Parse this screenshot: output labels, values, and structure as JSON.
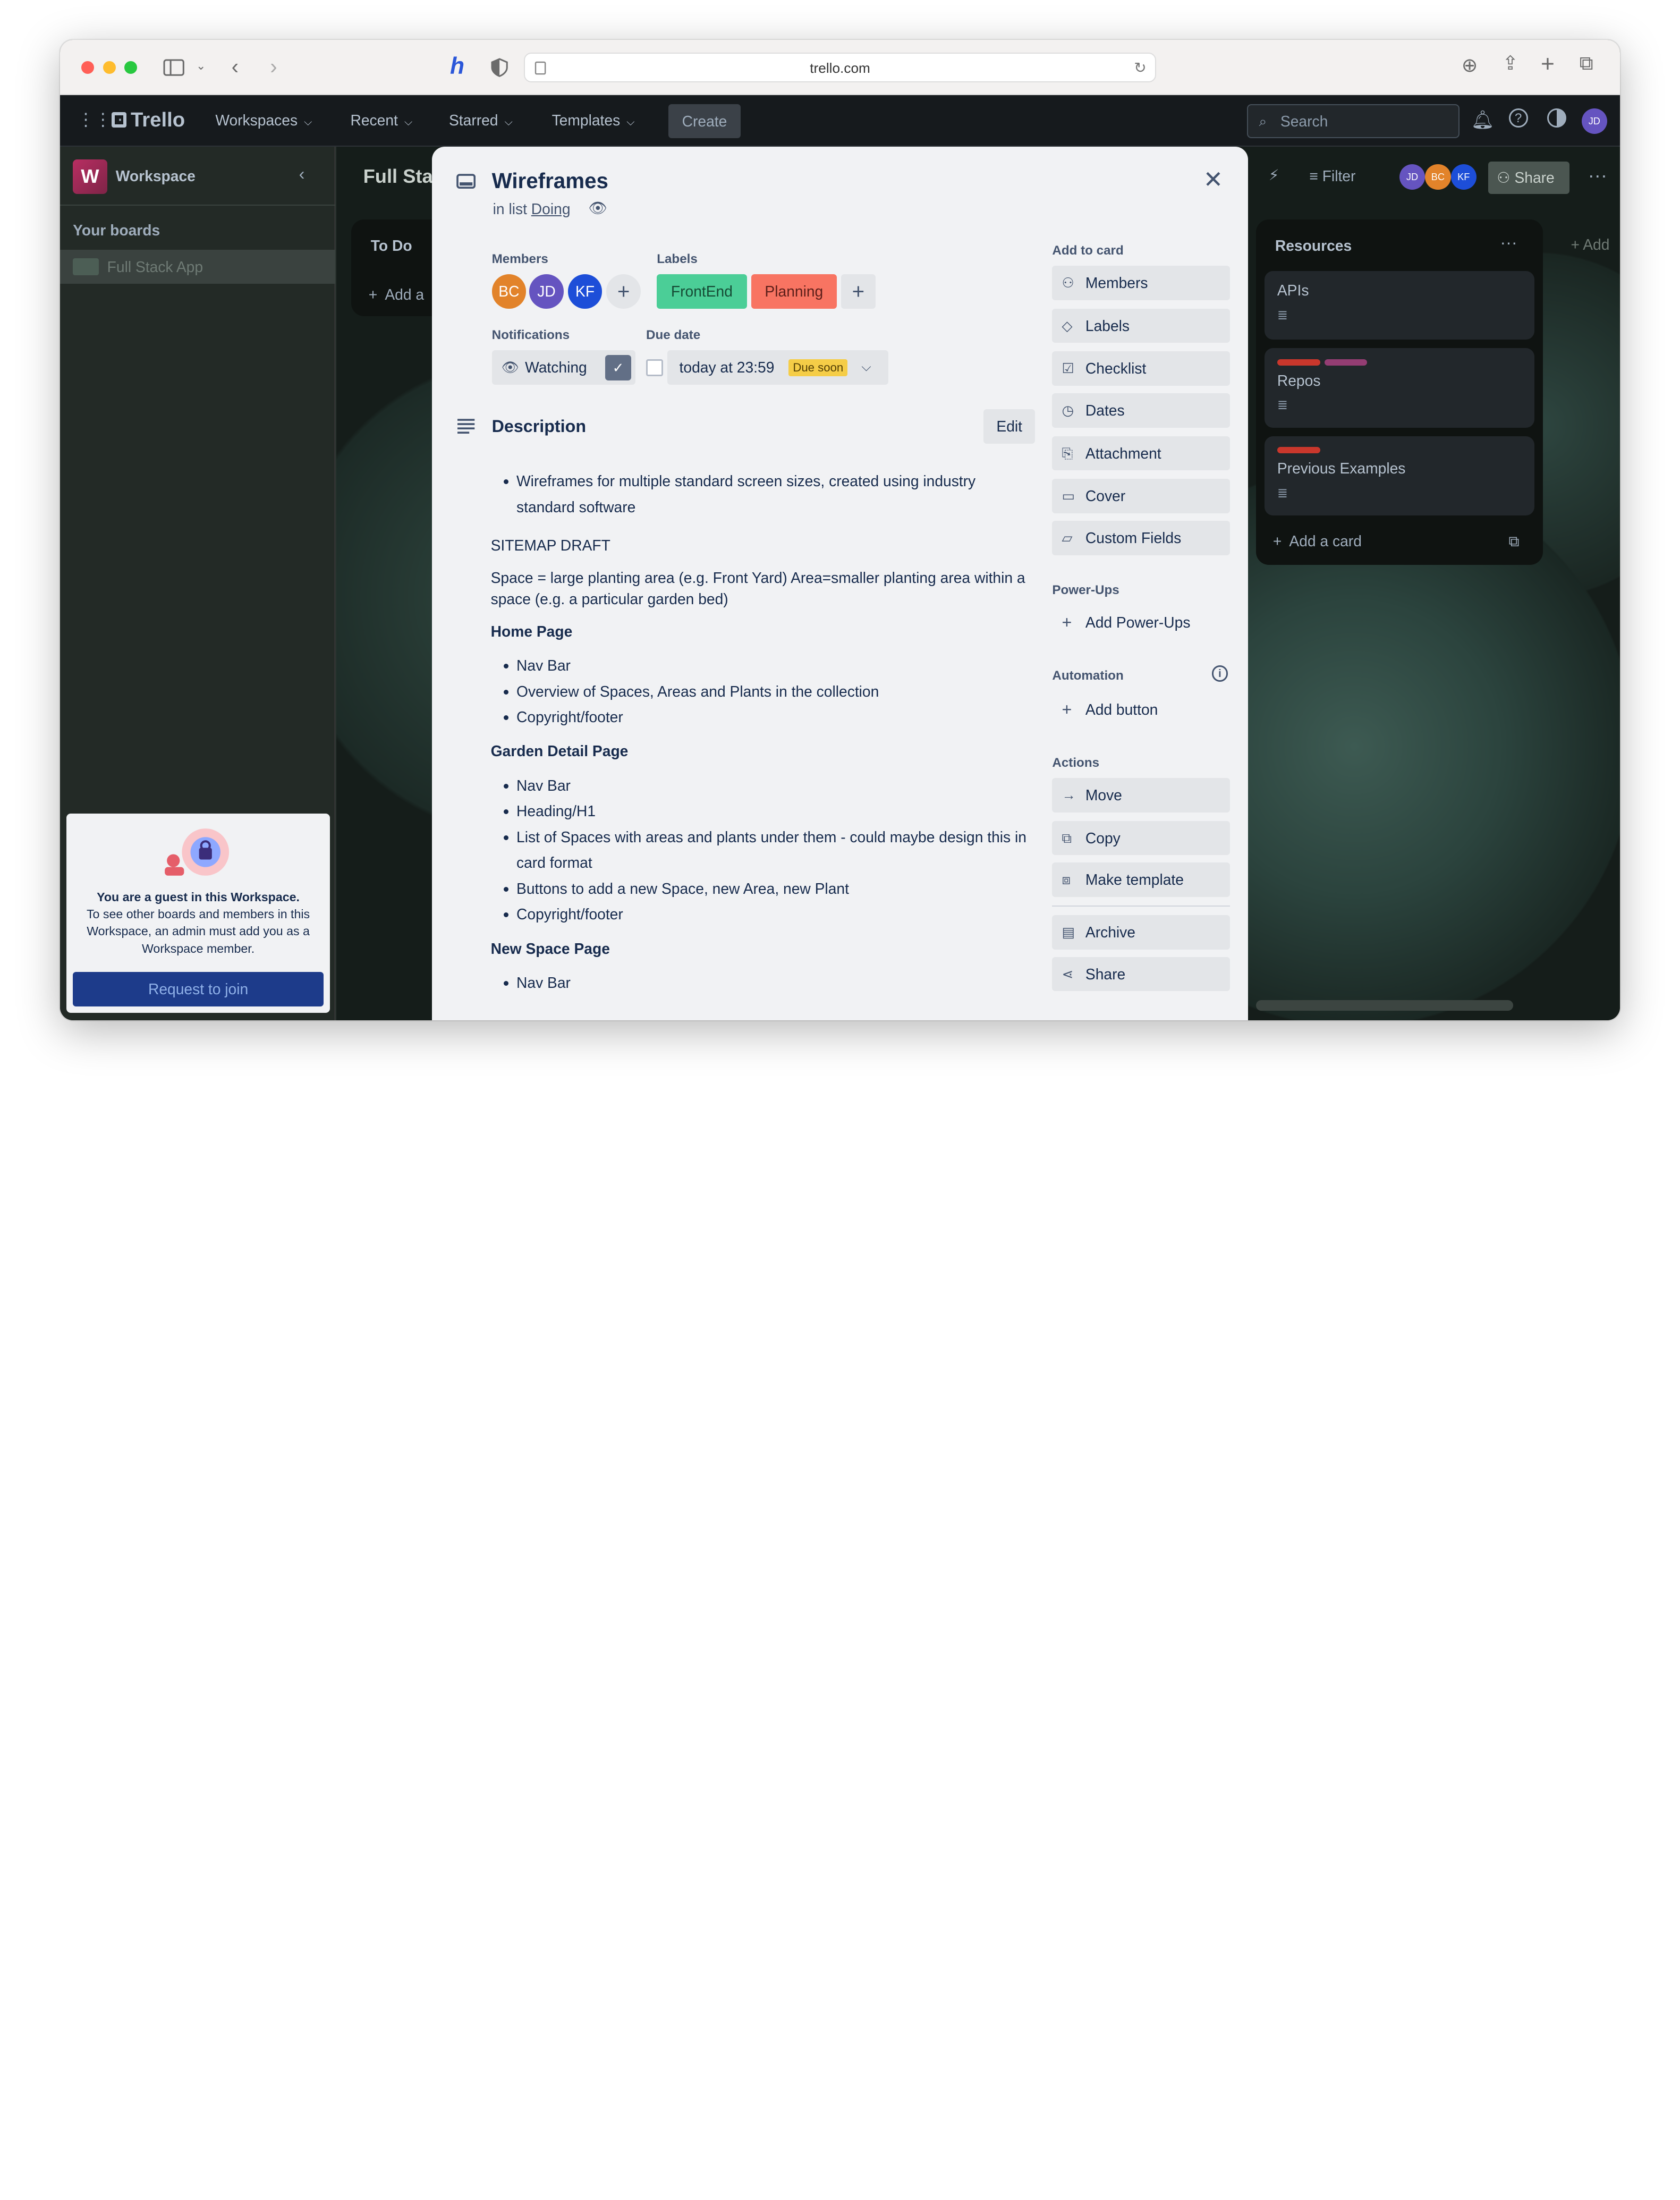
{
  "browser": {
    "url": "trello.com"
  },
  "header": {
    "logo": "Trello",
    "menus": [
      "Workspaces",
      "Recent",
      "Starred",
      "Templates"
    ],
    "create_label": "Create",
    "search_placeholder": "Search",
    "user_initials": "JD"
  },
  "sidebar": {
    "workspace_initial": "W",
    "workspace_name": "Workspace",
    "your_boards": "Your boards",
    "board_name": "Full Stack App",
    "guest_bold": "You are a guest in this Workspace.",
    "guest_text": "To see other boards and members in this Workspace, an admin must add you as a Workspace member.",
    "join_label": "Request to join"
  },
  "board": {
    "title": "Full Sta",
    "filter_label": "Filter",
    "share_label": "Share",
    "members": [
      "JD",
      "BC",
      "KF"
    ],
    "todo_title": "To Do",
    "todo_add": "Add a",
    "resources_title": "Resources",
    "add_list": "+ Add",
    "cards": [
      "APIs",
      "Repos",
      "Previous Examples"
    ],
    "add_card": "Add a card"
  },
  "card": {
    "title": "Wireframes",
    "in_list_prefix": "in list",
    "list_name": "Doing",
    "members_label": "Members",
    "members": [
      {
        "initials": "BC",
        "color": "#e2832a"
      },
      {
        "initials": "JD",
        "color": "#6554c0"
      },
      {
        "initials": "KF",
        "color": "#1d4ed8"
      }
    ],
    "labels_label": "Labels",
    "labels": [
      {
        "name": "FrontEnd",
        "color": "#4bce97"
      },
      {
        "name": "Planning",
        "color": "#f87462"
      }
    ],
    "notifications_label": "Notifications",
    "watching_label": "Watching",
    "due_label": "Due date",
    "due_value": "today at 23:59",
    "due_badge": "Due soon",
    "description_label": "Description",
    "edit_label": "Edit",
    "description": {
      "intro": "Wireframes for multiple standard screen sizes, created using industry standard software",
      "sitemap": "SITEMAP DRAFT",
      "space_def": "Space = large planting area (e.g. Front Yard) Area=smaller planting area within a space (e.g. a particular garden bed)",
      "home_heading": "Home Page",
      "home_items": [
        "Nav Bar",
        "Overview of Spaces, Areas and Plants in the collection",
        "Copyright/footer"
      ],
      "garden_heading": "Garden Detail Page",
      "garden_items": [
        "Nav Bar",
        "Heading/H1",
        "List of Spaces with areas and plants under them - could maybe design this in card format",
        "Buttons to add a new Space, new Area, new Plant",
        "Copyright/footer"
      ],
      "newspace_heading": "New Space Page",
      "newspace_items": [
        "Nav Bar"
      ]
    },
    "add_to_card_label": "Add to card",
    "add_to_card": [
      "Members",
      "Labels",
      "Checklist",
      "Dates",
      "Attachment",
      "Cover",
      "Custom Fields"
    ],
    "powerups_label": "Power-Ups",
    "add_powerups": "Add Power-Ups",
    "automation_label": "Automation",
    "add_button": "Add button",
    "actions_label": "Actions",
    "actions": [
      "Move",
      "Copy",
      "Make template"
    ],
    "archive": "Archive",
    "share": "Share"
  }
}
